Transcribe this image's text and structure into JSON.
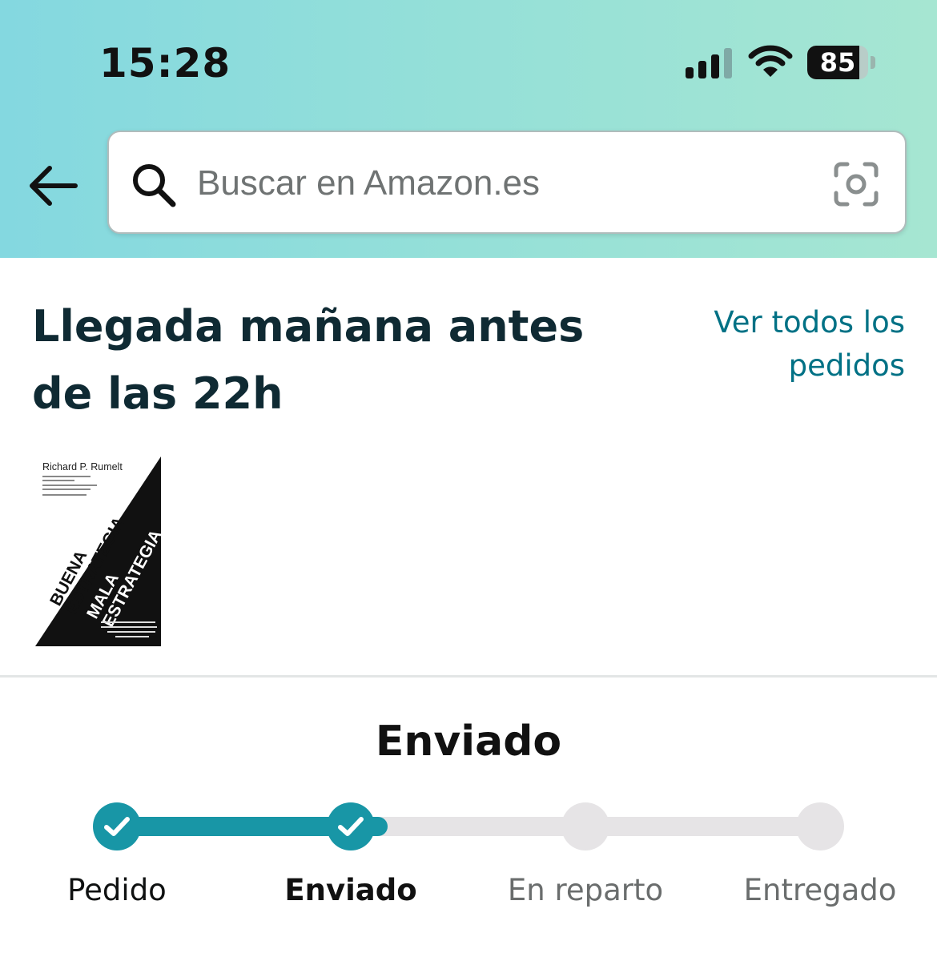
{
  "status_bar": {
    "time": "15:28",
    "battery_percent": "85",
    "battery_level": 0.85
  },
  "search": {
    "placeholder": "Buscar en Amazon.es"
  },
  "order": {
    "arrival_title": "Llegada mañana antes de las 22h",
    "view_all_link": "Ver todos los pedidos",
    "book": {
      "author": "Richard P. Rumelt",
      "title_line1": "BUENA",
      "title_line2": "ESTRATEGIA",
      "title_line3": "MALA",
      "title_line4": "ESTRATEGIA"
    }
  },
  "tracking": {
    "status_heading": "Enviado",
    "progress": 0.385,
    "steps": [
      {
        "label": "Pedido",
        "state": "done"
      },
      {
        "label": "Enviado",
        "state": "current"
      },
      {
        "label": "En reparto",
        "state": "pending"
      },
      {
        "label": "Entregado",
        "state": "pending"
      }
    ]
  },
  "colors": {
    "accent": "#1896a6",
    "link": "#007185",
    "header_gradient_start": "#84d8e0",
    "header_gradient_end": "#a6e6d2"
  }
}
